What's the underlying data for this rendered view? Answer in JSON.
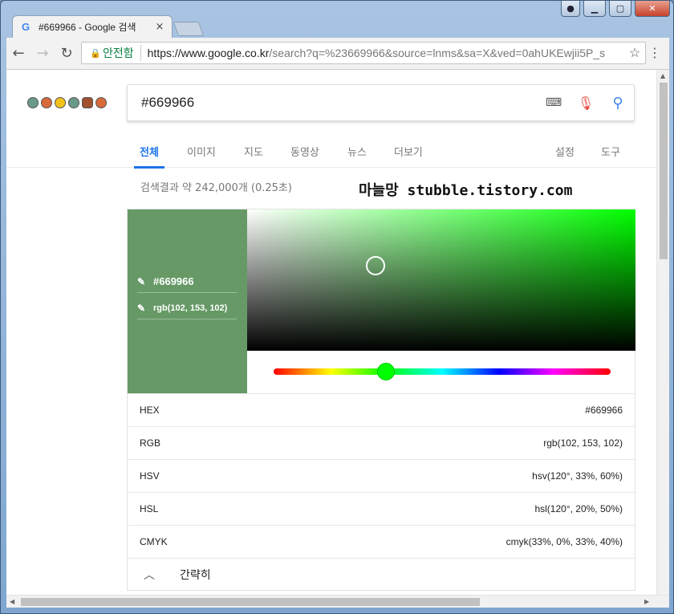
{
  "browser": {
    "tab_title": "#669966 - Google 검색",
    "tab_close": "×",
    "security_label": "안전함",
    "url_host": "https://www.google.co.kr",
    "url_path": "/search?q=%23669966&source=lnms&sa=X&ved=0ahUKEwjii5P_s"
  },
  "search": {
    "query": "#669966"
  },
  "tabs": [
    {
      "label": "전체"
    },
    {
      "label": "이미지"
    },
    {
      "label": "지도"
    },
    {
      "label": "동영상"
    },
    {
      "label": "뉴스"
    },
    {
      "label": "더보기"
    },
    {
      "label": "설정"
    },
    {
      "label": "도구"
    }
  ],
  "stats": "검색결과 약 242,000개 (0.25초)",
  "watermark": "마늘망 stubble.tistory.com",
  "picker": {
    "hex_field": "#669966",
    "rgb_field": "rgb(102, 153, 102)",
    "swatch_color": "#669966",
    "hue_color": "#00ff00",
    "saturation_percent": 33,
    "value_percent": 60,
    "hue_degrees": 120
  },
  "color_rows": [
    {
      "label": "HEX",
      "value": "#669966"
    },
    {
      "label": "RGB",
      "value": "rgb(102, 153, 102)"
    },
    {
      "label": "HSV",
      "value": "hsv(120°, 33%, 60%)"
    },
    {
      "label": "HSL",
      "value": "hsl(120°, 20%, 50%)"
    },
    {
      "label": "CMYK",
      "value": "cmyk(33%, 0%, 33%, 40%)"
    }
  ],
  "collapse_label": "간략히",
  "colors": {
    "accent": "#1a73e8",
    "secure": "#0b8043"
  }
}
